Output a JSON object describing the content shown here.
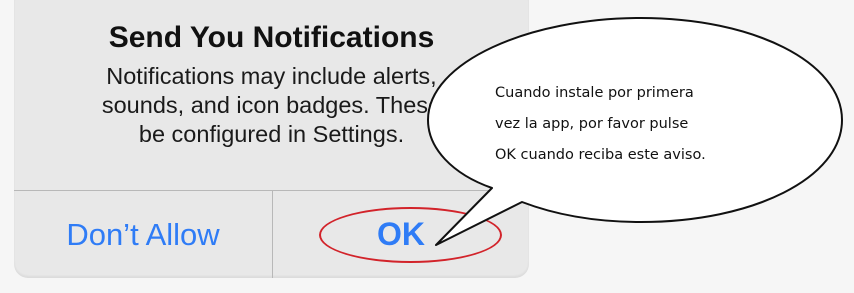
{
  "alert": {
    "title": "Send You Notifications",
    "body_lines": [
      "Notifications may include alerts,",
      "sounds, and icon badges. These",
      "be configured in Settings."
    ],
    "buttons": {
      "deny": "Don’t Allow",
      "ok": "OK"
    }
  },
  "callout": {
    "lines": [
      "Cuando instale por primera",
      "vez la app, por favor pulse",
      "OK cuando reciba este aviso."
    ]
  },
  "colors": {
    "button_text": "#2f7cf6",
    "highlight_ring": "#d2232a",
    "alert_background": "#e8e8e8"
  }
}
